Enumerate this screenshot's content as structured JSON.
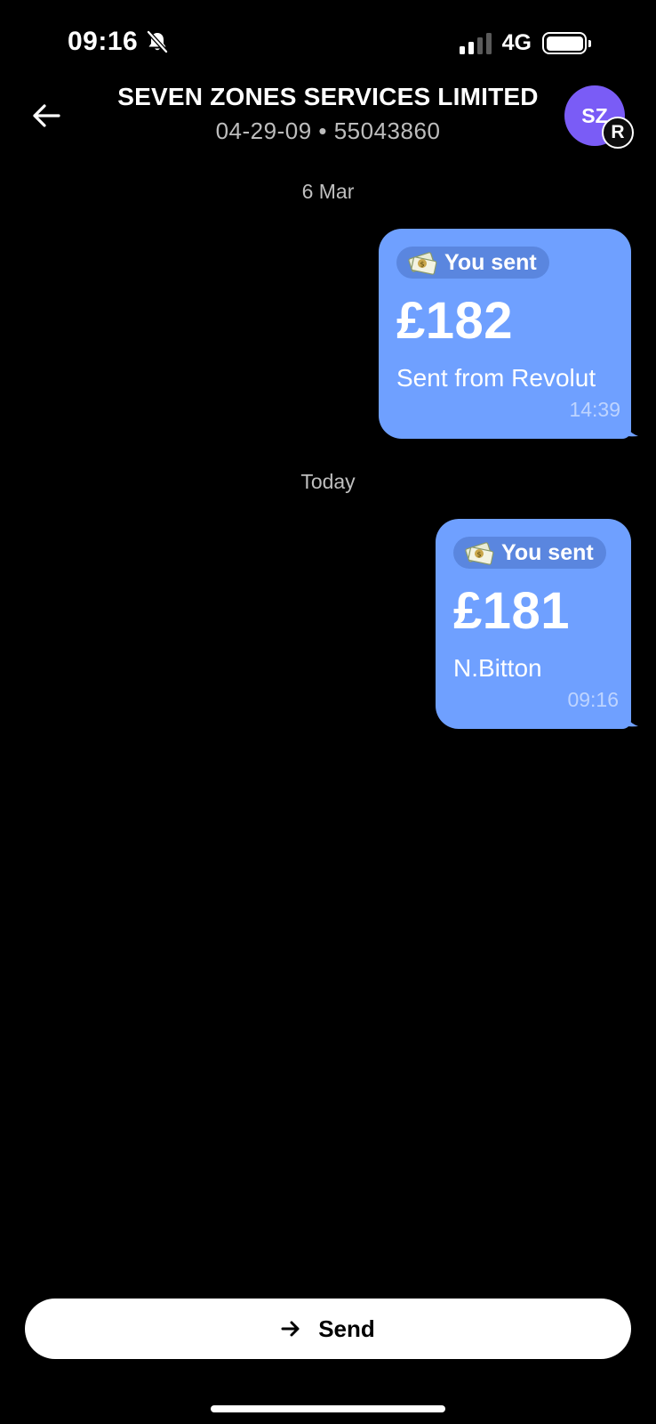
{
  "status_bar": {
    "time": "09:16",
    "network": "4G"
  },
  "header": {
    "title": "SEVEN ZONES SERVICES LIMITED",
    "subtitle": "04-29-09 • 55043860",
    "avatar_initials": "SZ",
    "badge_letter": "R"
  },
  "messages": [
    {
      "date": "6 Mar",
      "chip_label": "You sent",
      "amount": "£182",
      "note": "Sent from Revolut",
      "time": "14:39"
    },
    {
      "date": "Today",
      "chip_label": "You sent",
      "amount": "£181",
      "note": "N.Bitton",
      "time": "09:16"
    }
  ],
  "footer": {
    "send_label": "Send"
  },
  "colors": {
    "bubble": "#6fa0ff",
    "avatar": "#7a5cf6",
    "background": "#000000"
  },
  "icons": [
    "bell-slash-icon",
    "signal-icon",
    "battery-icon",
    "back-arrow-icon",
    "money-icon",
    "arrow-right-icon"
  ]
}
